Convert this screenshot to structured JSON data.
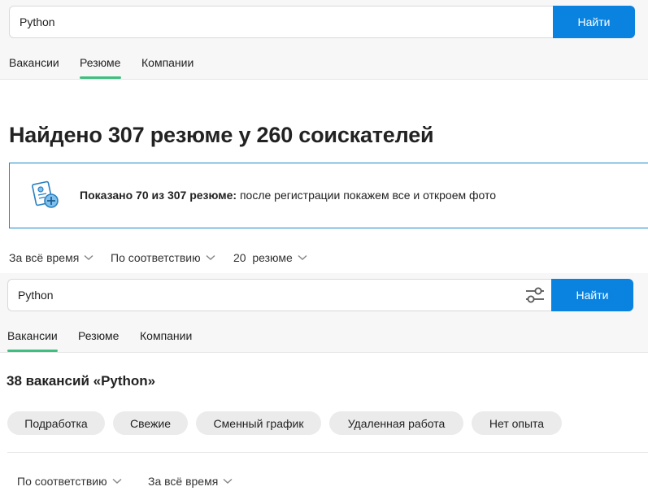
{
  "top_search": {
    "query": "Python",
    "button_label": "Найти",
    "tabs": [
      {
        "label": "Вакансии",
        "active": false
      },
      {
        "label": "Резюме",
        "active": true
      },
      {
        "label": "Компании",
        "active": false
      }
    ]
  },
  "results": {
    "heading": "Найдено 307 резюме у 260 соискателей"
  },
  "banner": {
    "bold_text": "Показано 70 из 307 резюме:",
    "text": " после регистрации покажем все и откроем фото"
  },
  "resume_filters": {
    "period": "За всё время",
    "sort": "По соответствию",
    "per_page": "20  резюме"
  },
  "bottom_search": {
    "query": "Python",
    "button_label": "Найти",
    "tabs": [
      {
        "label": "Вакансии",
        "active": true
      },
      {
        "label": "Резюме",
        "active": false
      },
      {
        "label": "Компании",
        "active": false
      }
    ]
  },
  "vacancies": {
    "heading": "38 вакансий «Python»",
    "chips": [
      "Подработка",
      "Свежие",
      "Сменный график",
      "Удаленная работа",
      "Нет опыта"
    ],
    "sort": "По соответствию",
    "period": "За всё время"
  },
  "colors": {
    "accent_blue": "#0a83e0",
    "tab_underline_green": "#3fbf7f",
    "banner_border": "#1a87c8"
  }
}
